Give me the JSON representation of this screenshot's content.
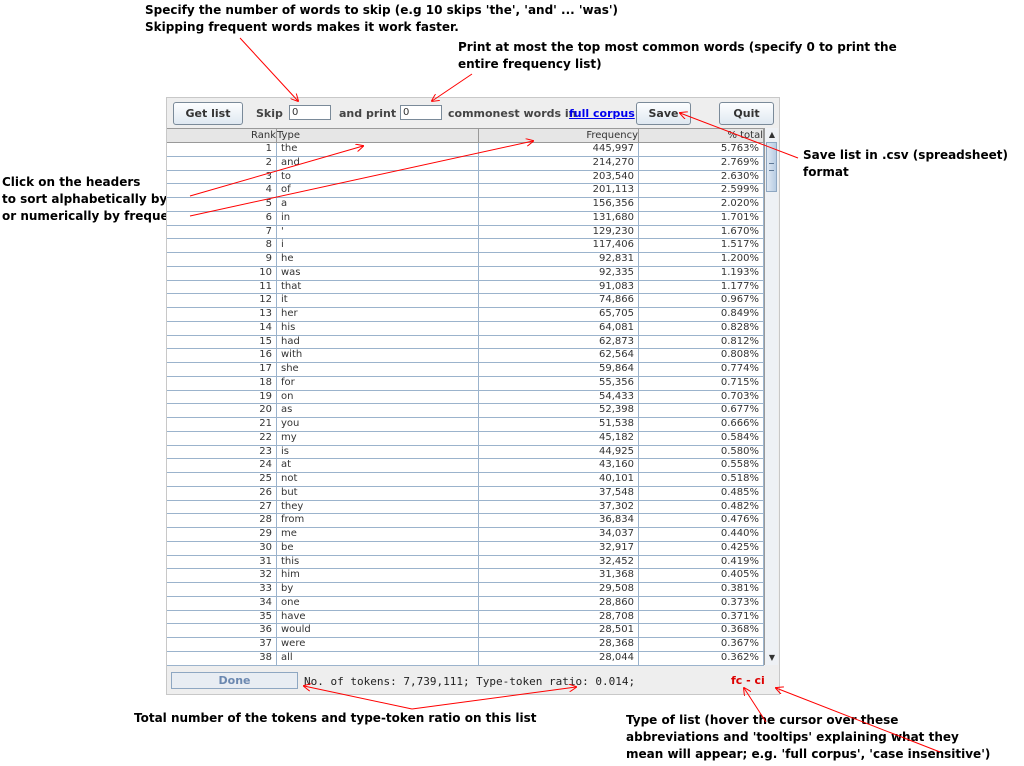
{
  "annotations": {
    "skip_line1": "Specify the number of words to skip (e.g 10 skips 'the', 'and' ... 'was')",
    "skip_line2": "Skipping frequent words makes it work faster.",
    "print_line1": "Print at most the top most common words (specify 0 to print the",
    "print_line2": "entire frequency list)",
    "headers_line1": "Click on the headers",
    "headers_line2": "to sort alphabetically by type",
    "headers_line3": "or numerically by frequency etc",
    "save_line1": "Save list in .csv (spreadsheet)",
    "save_line2": "format",
    "tokens_line": "Total number of the tokens and type-token ratio on this list",
    "type_line1": "Type of list (hover the cursor over these",
    "type_line2": "abbreviations and 'tooltips' explaining what they",
    "type_line3": "mean will appear; e.g. 'full corpus', 'case insensitive')"
  },
  "toolbar": {
    "get_list_label": "Get list",
    "skip_label": "Skip",
    "skip_value": "0",
    "and_print_label": "and print",
    "print_value": "0",
    "commonest_label": "commonest words in",
    "corpus_link": "full corpus",
    "save_label": "Save",
    "quit_label": "Quit"
  },
  "table": {
    "headers": [
      "Rank",
      "Type",
      "Frequency",
      "% total"
    ],
    "rows": [
      [
        "1",
        "the",
        "445,997",
        "5.763%"
      ],
      [
        "2",
        "and",
        "214,270",
        "2.769%"
      ],
      [
        "3",
        "to",
        "203,540",
        "2.630%"
      ],
      [
        "4",
        "of",
        "201,113",
        "2.599%"
      ],
      [
        "5",
        "a",
        "156,356",
        "2.020%"
      ],
      [
        "6",
        "in",
        "131,680",
        "1.701%"
      ],
      [
        "7",
        "'",
        "129,230",
        "1.670%"
      ],
      [
        "8",
        "i",
        "117,406",
        "1.517%"
      ],
      [
        "9",
        "he",
        "92,831",
        "1.200%"
      ],
      [
        "10",
        "was",
        "92,335",
        "1.193%"
      ],
      [
        "11",
        "that",
        "91,083",
        "1.177%"
      ],
      [
        "12",
        "it",
        "74,866",
        "0.967%"
      ],
      [
        "13",
        "her",
        "65,705",
        "0.849%"
      ],
      [
        "14",
        "his",
        "64,081",
        "0.828%"
      ],
      [
        "15",
        "had",
        "62,873",
        "0.812%"
      ],
      [
        "16",
        "with",
        "62,564",
        "0.808%"
      ],
      [
        "17",
        "she",
        "59,864",
        "0.774%"
      ],
      [
        "18",
        "for",
        "55,356",
        "0.715%"
      ],
      [
        "19",
        "on",
        "54,433",
        "0.703%"
      ],
      [
        "20",
        "as",
        "52,398",
        "0.677%"
      ],
      [
        "21",
        "you",
        "51,538",
        "0.666%"
      ],
      [
        "22",
        "my",
        "45,182",
        "0.584%"
      ],
      [
        "23",
        "is",
        "44,925",
        "0.580%"
      ],
      [
        "24",
        "at",
        "43,160",
        "0.558%"
      ],
      [
        "25",
        "not",
        "40,101",
        "0.518%"
      ],
      [
        "26",
        "but",
        "37,548",
        "0.485%"
      ],
      [
        "27",
        "they",
        "37,302",
        "0.482%"
      ],
      [
        "28",
        "from",
        "36,834",
        "0.476%"
      ],
      [
        "29",
        "me",
        "34,037",
        "0.440%"
      ],
      [
        "30",
        "be",
        "32,917",
        "0.425%"
      ],
      [
        "31",
        "this",
        "32,452",
        "0.419%"
      ],
      [
        "32",
        "him",
        "31,368",
        "0.405%"
      ],
      [
        "33",
        "by",
        "29,508",
        "0.381%"
      ],
      [
        "34",
        "one",
        "28,860",
        "0.373%"
      ],
      [
        "35",
        "have",
        "28,708",
        "0.371%"
      ],
      [
        "36",
        "would",
        "28,501",
        "0.368%"
      ],
      [
        "37",
        "were",
        "28,368",
        "0.367%"
      ],
      [
        "38",
        "all",
        "28,044",
        "0.362%"
      ]
    ]
  },
  "status": {
    "done_label": "Done",
    "stats_text": "No. of tokens: 7,739,111;  Type-token ratio: 0.014;",
    "list_type": "fc - ci"
  },
  "icons": {
    "scroll_up": "scroll-up-arrow-icon",
    "scroll_down": "scroll-down-arrow-icon"
  },
  "colors": {
    "arrow": "#ff0000",
    "link": "#0000ee",
    "list_type": "#dd0000"
  }
}
